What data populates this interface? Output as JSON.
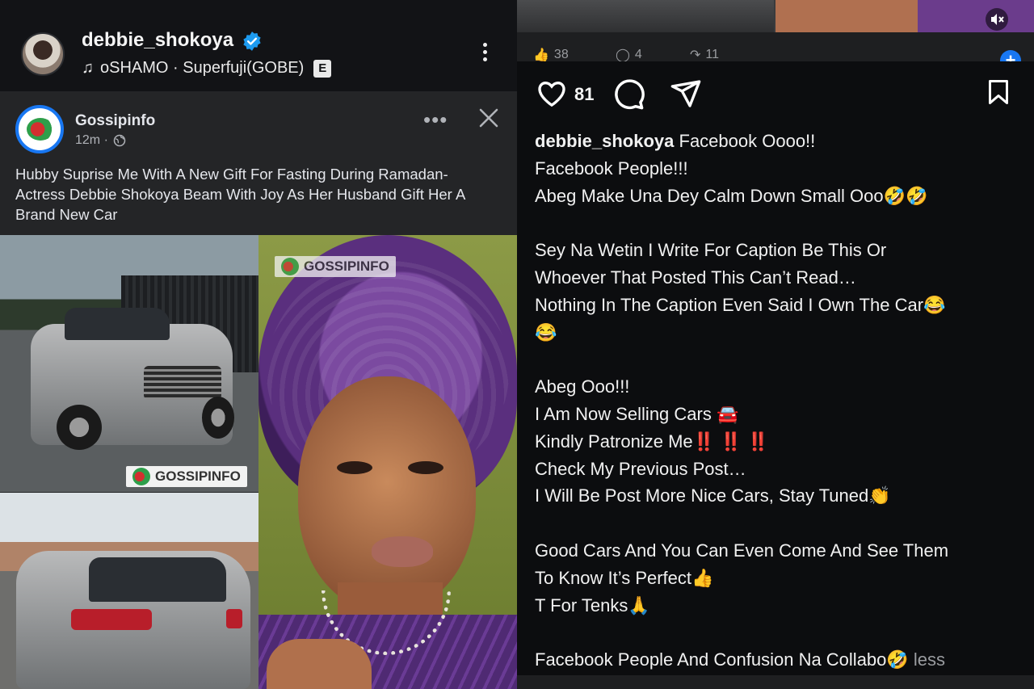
{
  "instagram": {
    "username": "debbie_shokoya",
    "audio": "oSHAMO · Superfuji(GOBE)",
    "explicit_badge": "E",
    "likes": "81",
    "caption_user": "debbie_shokoya",
    "caption_text": " Facebook Oooo!!\nFacebook People!!!\nAbeg Make Una Dey Calm Down Small Ooo🤣🤣\n\nSey Na Wetin I Write For Caption Be This Or\nWhoever That Posted This Can’t Read…\nNothing In The Caption Even Said I Own The Car😂\n😂\n\nAbeg Ooo!!!\nI Am Now Selling Cars 🚘\nKindly Patronize Me‼️ ‼️ ‼️\nCheck My Previous Post…\nI Will Be Post More Nice Cars, Stay Tuned👏\n\nGood Cars And You Can Even Come And See Them\nTo Know It’s Perfect👍\nT For Tenks🙏\n\nFacebook People And Confusion Na Collabo🤣 ",
    "less_label": "less",
    "background_strip": {
      "likes": "38",
      "comments": "4",
      "shares": "11"
    }
  },
  "facebook_post": {
    "page_name": "Gossipinfo",
    "time": "12m ·",
    "text": "Hubby Suprise Me With A New Gift For Fasting During Ramadan- Actress Debbie Shokoya Beam With Joy As Her Husband Gift Her A Brand New Car",
    "watermark": "GOSSIPINFO",
    "more_label": "•••"
  },
  "colors": {
    "verified_blue": "#1d9bf0",
    "facebook_blue": "#1877f2",
    "card_bg": "#242527"
  },
  "icons": [
    "verified-badge-icon",
    "music-note-icon",
    "more-vertical-icon",
    "globe-icon",
    "more-horizontal-icon",
    "close-icon",
    "mute-icon",
    "heart-icon",
    "comment-icon",
    "share-icon",
    "bookmark-icon"
  ]
}
